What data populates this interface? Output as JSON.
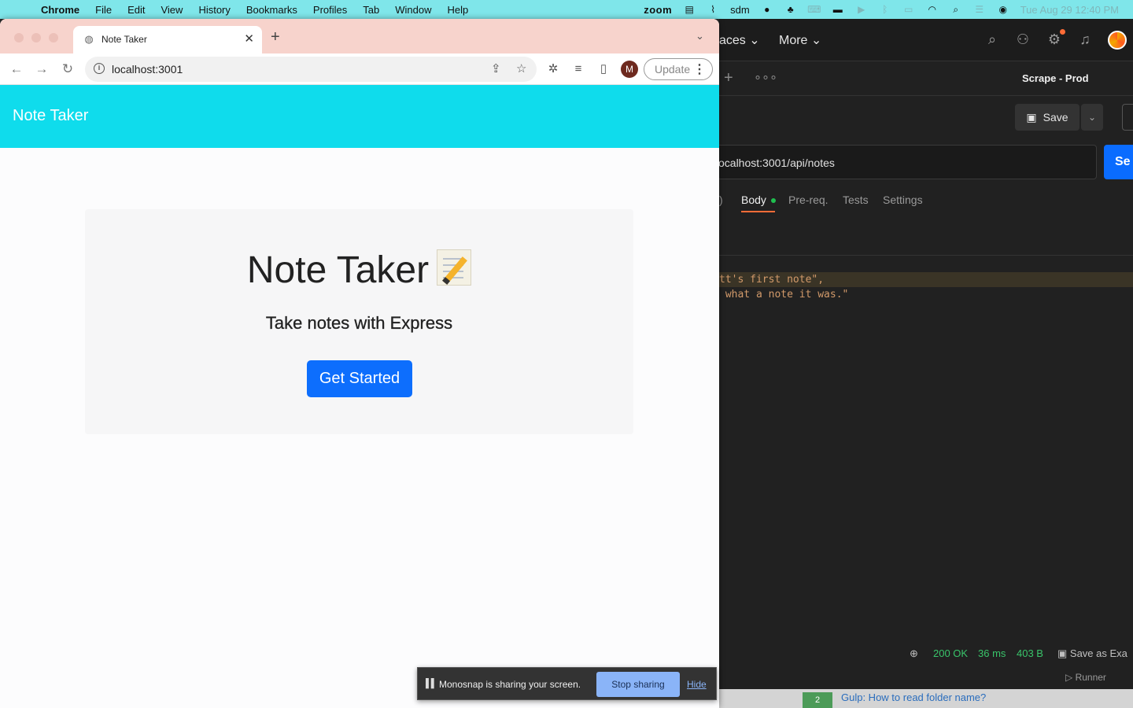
{
  "menubar": {
    "app": "Chrome",
    "items": [
      "File",
      "Edit",
      "View",
      "History",
      "Bookmarks",
      "Profiles",
      "Tab",
      "Window",
      "Help"
    ],
    "zoom": "zoom",
    "sdm": "sdm",
    "clock": "Tue Aug 29  12:40 PM"
  },
  "chrome": {
    "tab_title": "Note Taker",
    "url": "localhost:3001",
    "profile_initial": "M",
    "update_label": "Update"
  },
  "page": {
    "brand": "Note Taker",
    "heading": "Note Taker",
    "subheading": "Take notes with Express",
    "cta": "Get Started"
  },
  "postman": {
    "nav_workspaces": "aces",
    "nav_more": "More",
    "env": "Scrape - Prod",
    "save": "Save",
    "request_url": "ocalhost:3001/api/notes",
    "send": "Se",
    "subtab_prev": ")",
    "subtabs": [
      "Body",
      "Pre-req.",
      "Tests",
      "Settings"
    ],
    "code_line1": "tt's first note\",",
    "code_line2": " what a note it was.\"",
    "status": "200 OK",
    "time": "36 ms",
    "size": "403 B",
    "save_example": "Save as Exa",
    "runner": "Runner",
    "bottom_badge": "2",
    "bottom_link": "Gulp: How to read folder name?"
  },
  "monosnap": {
    "message": "Monosnap is sharing your screen.",
    "stop": "Stop sharing",
    "hide": "Hide"
  },
  "colors": {
    "navbar": "#0fdcec",
    "primary_button": "#0d6efd",
    "menubar": "#7fe6ea",
    "postman_accent": "#ff6c37"
  }
}
